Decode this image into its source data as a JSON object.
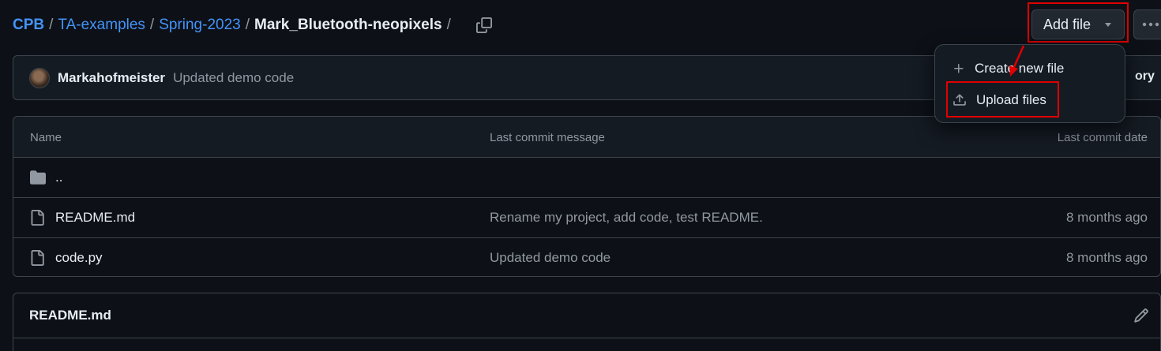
{
  "breadcrumb": {
    "items": [
      "CPB",
      "TA-examples",
      "Spring-2023"
    ],
    "separator": "/",
    "current": "Mark_Bluetooth-neopixels",
    "trailing_separator": "/"
  },
  "header": {
    "add_file_label": "Add file",
    "more_icon": "kebab-horizontal-icon",
    "copy_icon": "copy-icon"
  },
  "add_file_menu": {
    "items": [
      {
        "label": "Create new file",
        "icon": "plus-icon"
      },
      {
        "label": "Upload files",
        "icon": "upload-icon"
      }
    ]
  },
  "commit": {
    "author": "Markahofmeister",
    "message": "Updated demo code",
    "history_partial": "ory"
  },
  "table": {
    "headers": {
      "name": "Name",
      "message": "Last commit message",
      "date": "Last commit date"
    },
    "rows": [
      {
        "name": "..",
        "type": "parent-directory",
        "icon": "folder-icon",
        "message": "",
        "date": ""
      },
      {
        "name": "README.md",
        "type": "file",
        "icon": "file-icon",
        "message": "Rename my project, add code, test README.",
        "date": "8 months ago"
      },
      {
        "name": "code.py",
        "type": "file",
        "icon": "file-icon",
        "message": "Updated demo code",
        "date": "8 months ago"
      }
    ]
  },
  "readme": {
    "title": "README.md",
    "edit_icon": "pencil-icon"
  },
  "colors": {
    "background": "#0d1117",
    "link": "#4493f8",
    "annotation": "#e00000",
    "border": "#3d444d"
  }
}
